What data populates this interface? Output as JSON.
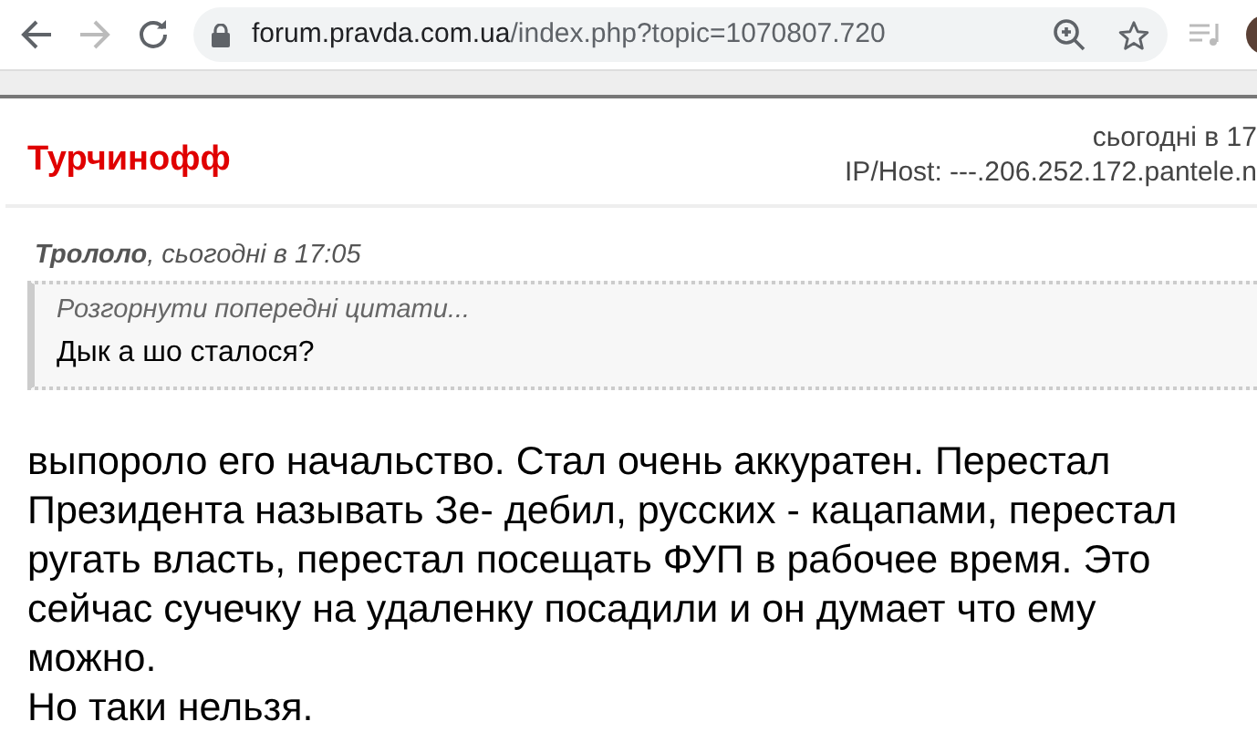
{
  "browser": {
    "url_host": "forum.pravda.com.ua",
    "url_path": "/index.php?topic=1070807.720",
    "back_disabled": false,
    "forward_disabled": true
  },
  "post": {
    "author": "Турчинофф",
    "date": "сьогодні в 17",
    "ip": "IP/Host: ---.206.252.172.pantele.n",
    "quote": {
      "author": "Трололо",
      "meta": ", сьогодні в 17:05",
      "expand": "Розгорнути попередні цитати...",
      "text": "Дык а шо сталося?"
    },
    "body_lines": [
      "выпороло его начальство. Стал очень аккуратен. Перестал",
      "Президента называть Зе- дебил, русских - кацапами, перестал",
      "ругать власть, перестал посещать ФУП в рабочее время. Это",
      "сейчас сучечку на удаленку посадили и он думает что ему",
      "можно.",
      "Но таки нельзя."
    ]
  }
}
